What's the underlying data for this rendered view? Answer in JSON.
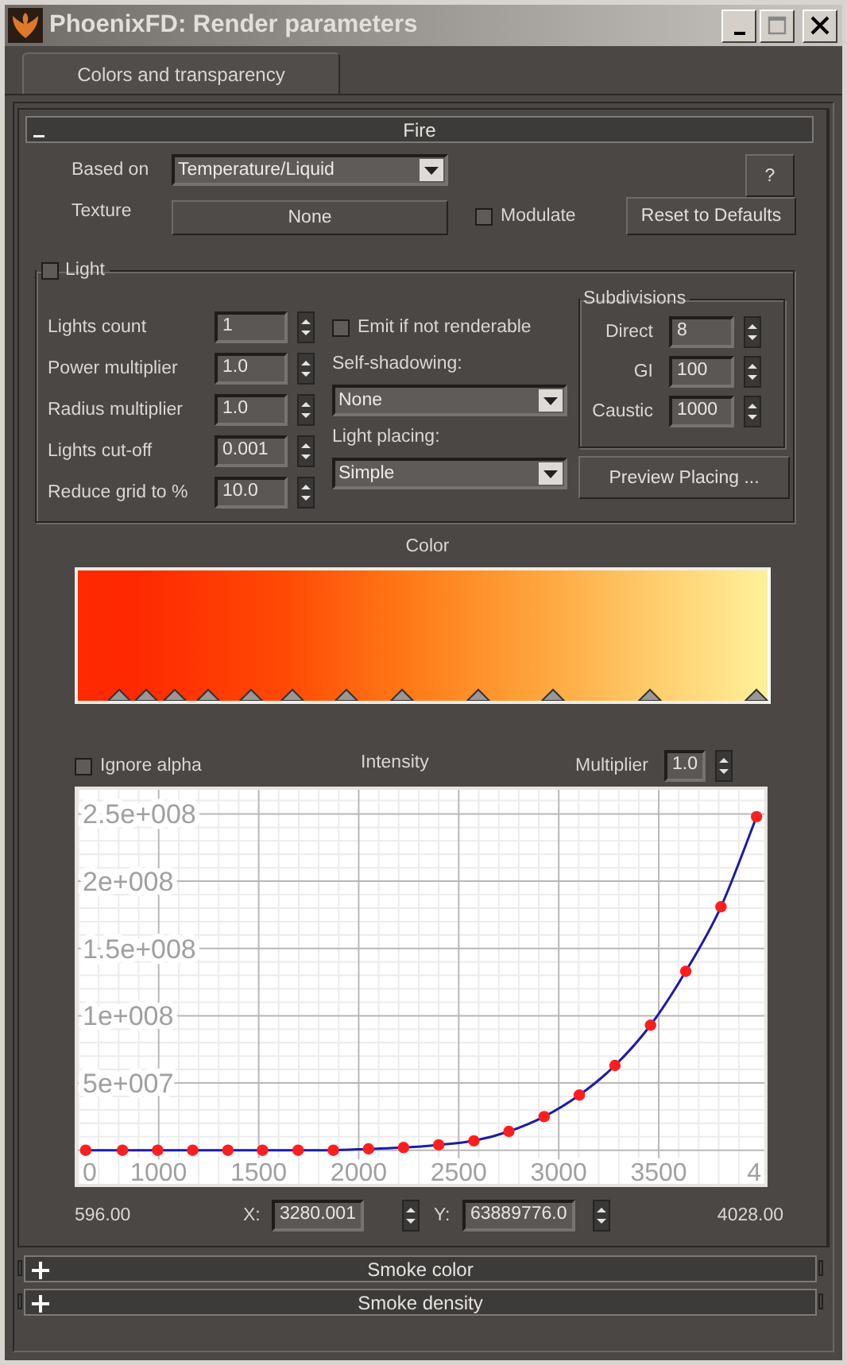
{
  "window": {
    "title": "PhoenixFD: Render parameters"
  },
  "tabs": [
    {
      "label": "Colors and transparency",
      "selected": true
    }
  ],
  "rollouts": [
    {
      "title": "Fire",
      "expanded": true,
      "body": {
        "based_on": {
          "label": "Based on",
          "value": "Temperature/Liquid"
        },
        "help_button": "?",
        "texture": {
          "label": "Texture",
          "button": "None"
        },
        "modulate": {
          "label": "Modulate",
          "checked": false
        },
        "reset_button": "Reset to Defaults",
        "light": {
          "label": "Light",
          "checked": false,
          "fields": [
            {
              "label": "Lights count",
              "value": "1"
            },
            {
              "label": "Power multiplier",
              "value": "1.0"
            },
            {
              "label": "Radius multiplier",
              "value": "1.0"
            },
            {
              "label": "Lights cut-off",
              "value": "0.001"
            },
            {
              "label": "Reduce grid to %",
              "value": "10.0"
            }
          ],
          "emit": {
            "label": "Emit if not renderable",
            "checked": false
          },
          "self_shadowing": {
            "label": "Self-shadowing:",
            "value": "None"
          },
          "light_placing": {
            "label": "Light placing:",
            "value": "Simple"
          },
          "subdivisions": {
            "title": "Subdivisions",
            "fields": [
              {
                "label": "Direct",
                "value": "8"
              },
              {
                "label": "GI",
                "value": "100"
              },
              {
                "label": "Caustic",
                "value": "1000"
              }
            ]
          },
          "preview_button": "Preview Placing ..."
        },
        "color": {
          "title": "Color"
        },
        "intensity": {
          "ignore_alpha": {
            "label": "Ignore alpha",
            "checked": false
          },
          "multiplier": {
            "label": "Multiplier",
            "value": "1.0"
          },
          "chart_data": {
            "type": "line",
            "grid": true,
            "xlim": [
              596,
              4028
            ],
            "ylim": [
              -25000000,
              268000000
            ],
            "x": [
              635,
              819,
              995,
              1170,
              1346,
              1519,
              1697,
              1873,
              2049,
              2224,
              2400,
              2576,
              2751,
              2927,
              3103,
              3281,
              3459,
              3635,
              3811,
              3989
            ],
            "series": [
              {
                "name": "Intensity",
                "color": "#1c1ca8",
                "marker": "circle",
                "values": [
                  0,
                  0,
                  0,
                  0,
                  0,
                  0,
                  0,
                  0,
                  1000000,
                  2000000,
                  4000000,
                  7000000,
                  14000000,
                  25000000,
                  41000000,
                  63000000,
                  93000000,
                  133000000,
                  181000000,
                  248000000
                ]
              }
            ],
            "xticks": [
              1000,
              1500,
              2000,
              2500,
              3000,
              3500
            ],
            "yticks": [
              {
                "value": 50000000,
                "label": "5e+007"
              },
              {
                "value": 100000000,
                "label": "1e+008"
              },
              {
                "value": 150000000,
                "label": "1.5e+008"
              },
              {
                "value": 200000000,
                "label": "2e+008"
              },
              {
                "value": 250000000,
                "label": "2.5e+008"
              }
            ]
          },
          "origin_label": "0",
          "cut_label": "4",
          "range_min": "596.00",
          "x_field": {
            "label": "X:",
            "value": "3280.001"
          },
          "y_field": {
            "label": "Y:",
            "value": "63889776.0"
          },
          "range_max": "4028.00"
        }
      }
    },
    {
      "title": "Smoke color",
      "expanded": false
    },
    {
      "title": "Smoke density",
      "expanded": false
    }
  ]
}
